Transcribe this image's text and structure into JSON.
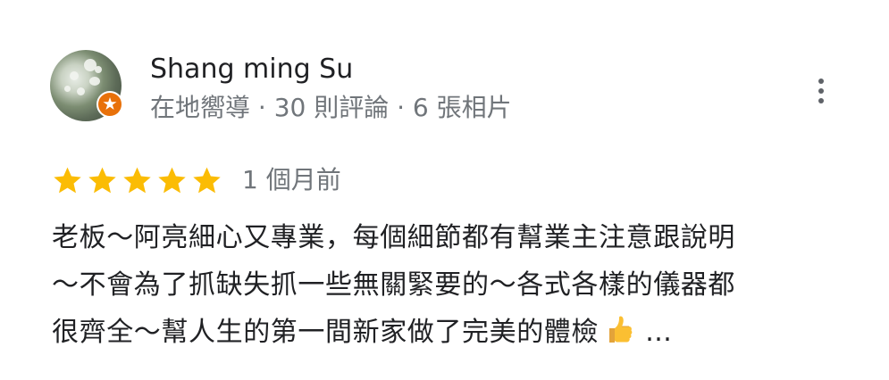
{
  "reviewer": {
    "name": "Shang ming Su",
    "meta": "在地嚮導 · 30 則評論 · 6 張相片"
  },
  "rating": {
    "stars": 5,
    "max_stars": 5,
    "date": "1 個月前"
  },
  "review": {
    "lines": [
      "老板～阿亮細心又專業，每個細節都有幫業主注意跟說明",
      "～不會為了抓缺失抓一些無關緊要的～各式各樣的儀器都",
      "很齊全～幫人生的第一間新家做了完美的體檢"
    ],
    "ellipsis": "…"
  },
  "colors": {
    "star": "#fbbc04",
    "badge": "#e8710a",
    "secondary_text": "#70757a",
    "primary_text": "#202124"
  },
  "icons": {
    "menu": "more-vert-icon",
    "badge": "local-guide-badge-icon",
    "emoji": "thumbs-up-icon"
  }
}
